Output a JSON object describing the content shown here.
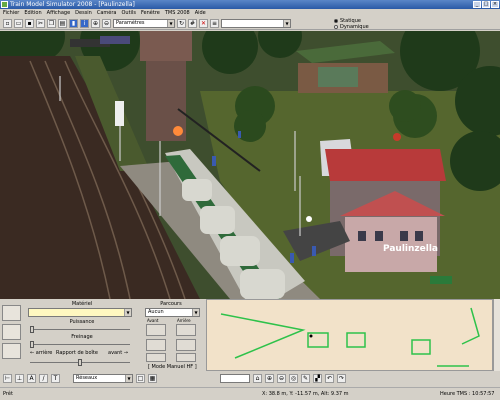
{
  "window": {
    "title": "Train Model Simulator 2008 - [Paulinzella]",
    "controls": [
      "_",
      "□",
      "×"
    ]
  },
  "menu": [
    "Fichier",
    "Edition",
    "Affichage",
    "Dessin",
    "Caméra",
    "Outils",
    "Fenêtre",
    "TMS 2008",
    "Aide"
  ],
  "toolbar": {
    "view_combo": "Paramètres",
    "object_combo": "",
    "mode_static": "Statique",
    "mode_dynamic": "Dynamique"
  },
  "scene": {
    "station_sign": "Paulinzella"
  },
  "panel": {
    "material_title": "Matériel",
    "material_value": "",
    "power_label": "Puissance",
    "brake_label": "Freinage",
    "gearbox_label": "Rapport de boîte",
    "gear_back": "← arrière",
    "gear_forward": "avant →",
    "route_title": "Parcours",
    "route_value": "Aucun",
    "front_label": "Avant",
    "rear_label": "Arrière",
    "mode_manual": "[ Mode Manuel HF ]"
  },
  "bottom_toolbar": {
    "combo": "Réseaux"
  },
  "status": {
    "ready": "Prêt",
    "coords": "X: 38.8 m, Y: -11.57 m, Alt: 9.37 m",
    "clock_label": "Heure TMS : 10:57:57"
  },
  "colors": {
    "title_bar": "#2a5aa6",
    "map_bg": "#f2e2c9",
    "map_track": "#2ec24a",
    "chrome": "#d4d0c8"
  }
}
